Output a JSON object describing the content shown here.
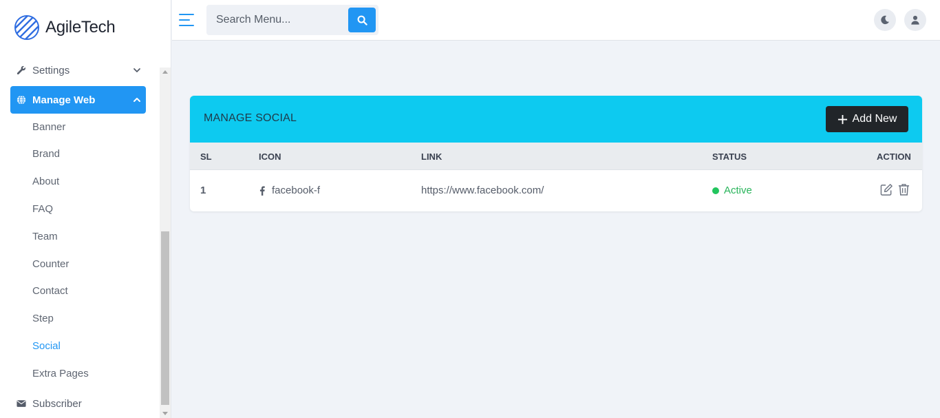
{
  "brand": {
    "name": "AgileTech"
  },
  "topbar": {
    "search_placeholder": "Search Menu..."
  },
  "sidebar": {
    "items": [
      {
        "label": "Settings",
        "icon": "wrench-icon"
      },
      {
        "label": "Manage Web",
        "icon": "globe-icon",
        "expanded": true
      },
      {
        "label": "Subscriber",
        "icon": "envelope-icon"
      }
    ],
    "submenu": [
      "Banner",
      "Brand",
      "About",
      "FAQ",
      "Team",
      "Counter",
      "Contact",
      "Step",
      "Social",
      "Extra Pages"
    ],
    "current_sub": "Social"
  },
  "card": {
    "title": "MANAGE SOCIAL",
    "add_label": "Add New",
    "columns": [
      "SL",
      "ICON",
      "LINK",
      "STATUS",
      "ACTION"
    ],
    "rows": [
      {
        "sl": "1",
        "icon_name": "facebook-f",
        "link": "https://www.facebook.com/",
        "status": "Active"
      }
    ]
  },
  "colors": {
    "primary": "#2196f3",
    "header_cyan": "#0dcaf0",
    "dark_button": "#212529",
    "active_green": "#22c55e"
  }
}
